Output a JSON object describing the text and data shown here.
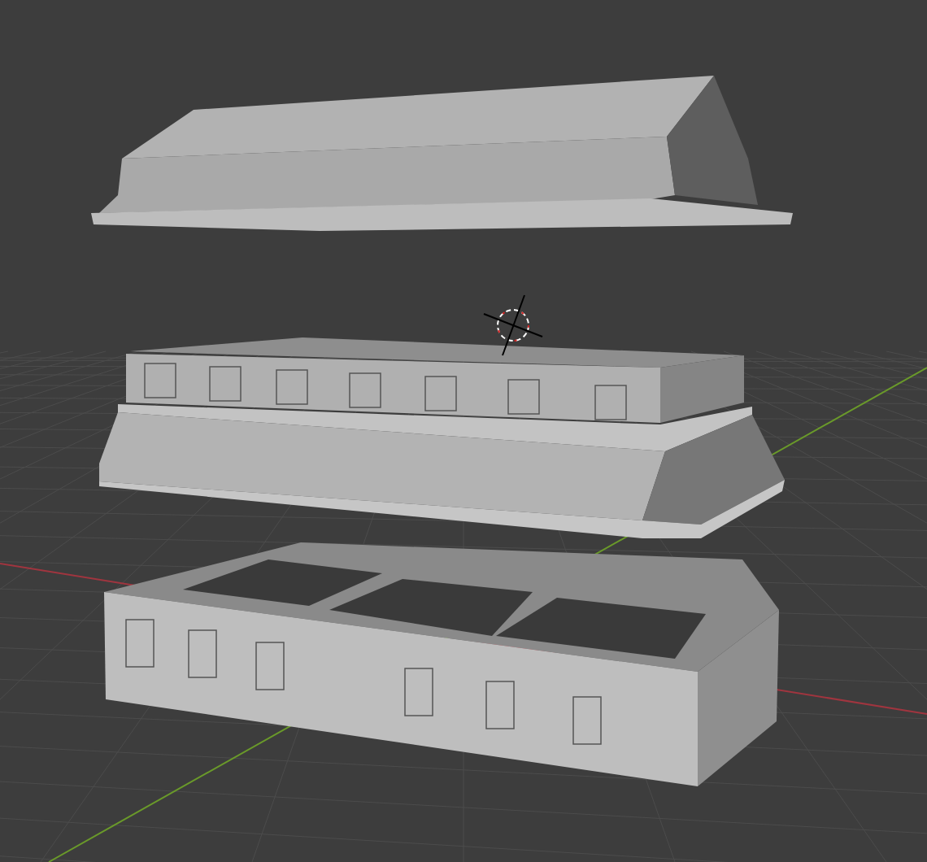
{
  "viewport": {
    "objects": [
      {
        "kind": "lid"
      },
      {
        "kind": "box"
      },
      {
        "kind": "tray"
      }
    ],
    "cursor": true
  }
}
